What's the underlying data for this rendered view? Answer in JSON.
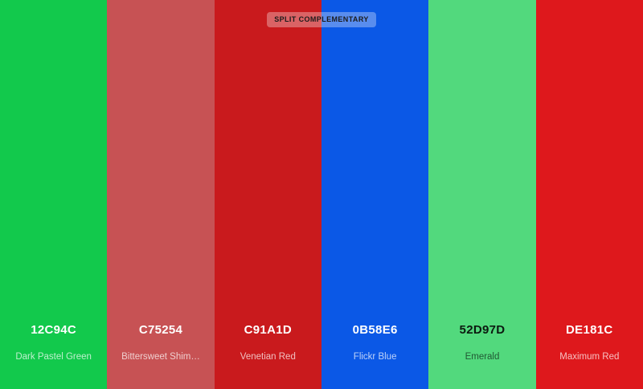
{
  "badge": {
    "label": "SPLIT COMPLEMENTARY"
  },
  "swatches": [
    {
      "hex": "12C94C",
      "name": "Dark Pastel Green",
      "color": "#12C94C",
      "text_tone": "light"
    },
    {
      "hex": "C75254",
      "name": "Bittersweet Shim…",
      "color": "#C75254",
      "text_tone": "light"
    },
    {
      "hex": "C91A1D",
      "name": "Venetian Red",
      "color": "#C91A1D",
      "text_tone": "light"
    },
    {
      "hex": "0B58E6",
      "name": "Flickr Blue",
      "color": "#0B58E6",
      "text_tone": "light"
    },
    {
      "hex": "52D97D",
      "name": "Emerald",
      "color": "#52D97D",
      "text_tone": "dark"
    },
    {
      "hex": "DE181C",
      "name": "Maximum Red",
      "color": "#DE181C",
      "text_tone": "light"
    }
  ]
}
